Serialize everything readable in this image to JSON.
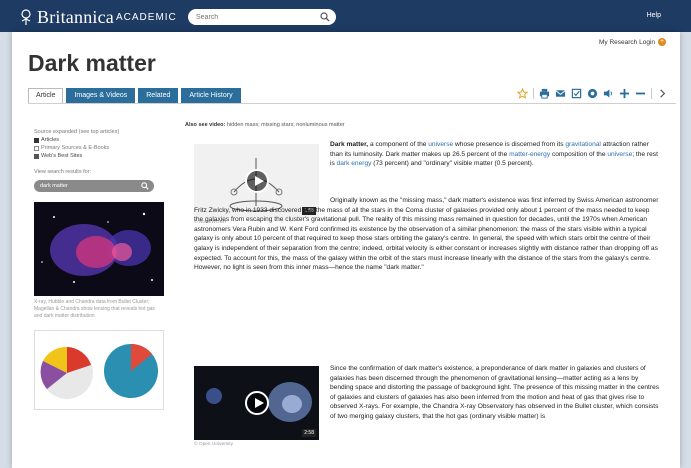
{
  "header": {
    "brand": "Britannica",
    "academic": "ACADEMIC",
    "search_placeholder": "Search",
    "help": "Help"
  },
  "account": {
    "research_login": "My Research Login"
  },
  "article": {
    "title": "Dark matter",
    "tabs": [
      {
        "label": "Article",
        "active": true
      },
      {
        "label": "Images & Videos",
        "active": false
      },
      {
        "label": "Related",
        "active": false
      },
      {
        "label": "Article History",
        "active": false
      }
    ],
    "toolbar_icons": [
      "star-icon",
      "print-icon",
      "email-icon",
      "cite-icon",
      "share-icon",
      "audio-icon",
      "increase-font-icon",
      "decrease-font-icon",
      "next-icon"
    ],
    "also_videos_label": "Also see video:",
    "also_videos_text": "hidden mass; missing stars; nonluminous matter"
  },
  "sidebar": {
    "related_label": "Source expanded (see top articles)",
    "links": [
      "Articles",
      "Primary Sources & E-Books",
      "Web's Best Sites"
    ],
    "search_label": "View search results for:",
    "search_pill": "dark matter",
    "image_caption": "X-ray, Hubble and Chandra data from Bullet Cluster; Magellan & Chandra show lensing that reveals hot gas and dark matter distribution"
  },
  "videos": [
    {
      "duration": "1:58",
      "caption": "© Nova/WGBH"
    },
    {
      "duration": "2:58",
      "caption": "© Open University"
    }
  ],
  "paragraphs": {
    "p1_lead": "Dark matter,",
    "p1_a": " a component of the ",
    "p1_universe": "universe",
    "p1_b": " whose presence is discerned from its ",
    "p1_gravitational": "gravitational",
    "p1_c": " attraction rather than its luminosity. Dark matter makes up 26.5 percent of the ",
    "p1_massenergy": "matter-energy",
    "p1_d": " composition of the ",
    "p1_universe2": "universe",
    "p1_e": "; the rest is ",
    "p1_darkenergy": "dark energy",
    "p1_f": " (73 percent) and \"ordinary\" visible matter (0.5 percent).",
    "p2": "Originally known as the \"missing mass,\" dark matter's existence was first inferred by Swiss American astronomer Fritz Zwicky, who in 1933 discovered that the mass of all the stars in the Coma cluster of galaxies provided only about 1 percent of the mass needed to keep the galaxies from escaping the cluster's gravitational pull. The reality of this missing mass remained in question for decades, until the 1970s when American astronomers Vera Rubin and W. Kent Ford confirmed its existence by the observation of a similar phenomenon: the mass of the stars visible within a typical galaxy is only about 10 percent of that required to keep those stars orbiting the galaxy's centre. In general, the speed with which stars orbit the centre of their galaxy is independent of their separation from the centre; indeed, orbital velocity is either constant or increases slightly with distance rather than dropping off as expected. To account for this, the mass of the galaxy within the orbit of the stars must increase linearly with the distance of the stars from the galaxy's centre. However, no light is seen from this inner mass—hence the name \"dark matter.\"",
    "p3": "Since the confirmation of dark matter's existence, a preponderance of dark matter in galaxies and clusters of galaxies has been discerned through the phenomenon of gravitational lensing—matter acting as a lens by bending space and distorting the passage of background light. The presence of this missing matter in the centres of galaxies and clusters of galaxies has also been inferred from the motion and heat of gas that gives rise to observed X-rays. For example, the Chandra X-ray Observatory has observed in the Bullet cluster, which consists of two merging galaxy clusters, that the hot gas (ordinary visible matter) is"
  },
  "colors": {
    "topbar": "#1e3b63",
    "tab": "#2b6e9c",
    "link": "#2f6fa9",
    "login_badge": "#e08a1c"
  }
}
